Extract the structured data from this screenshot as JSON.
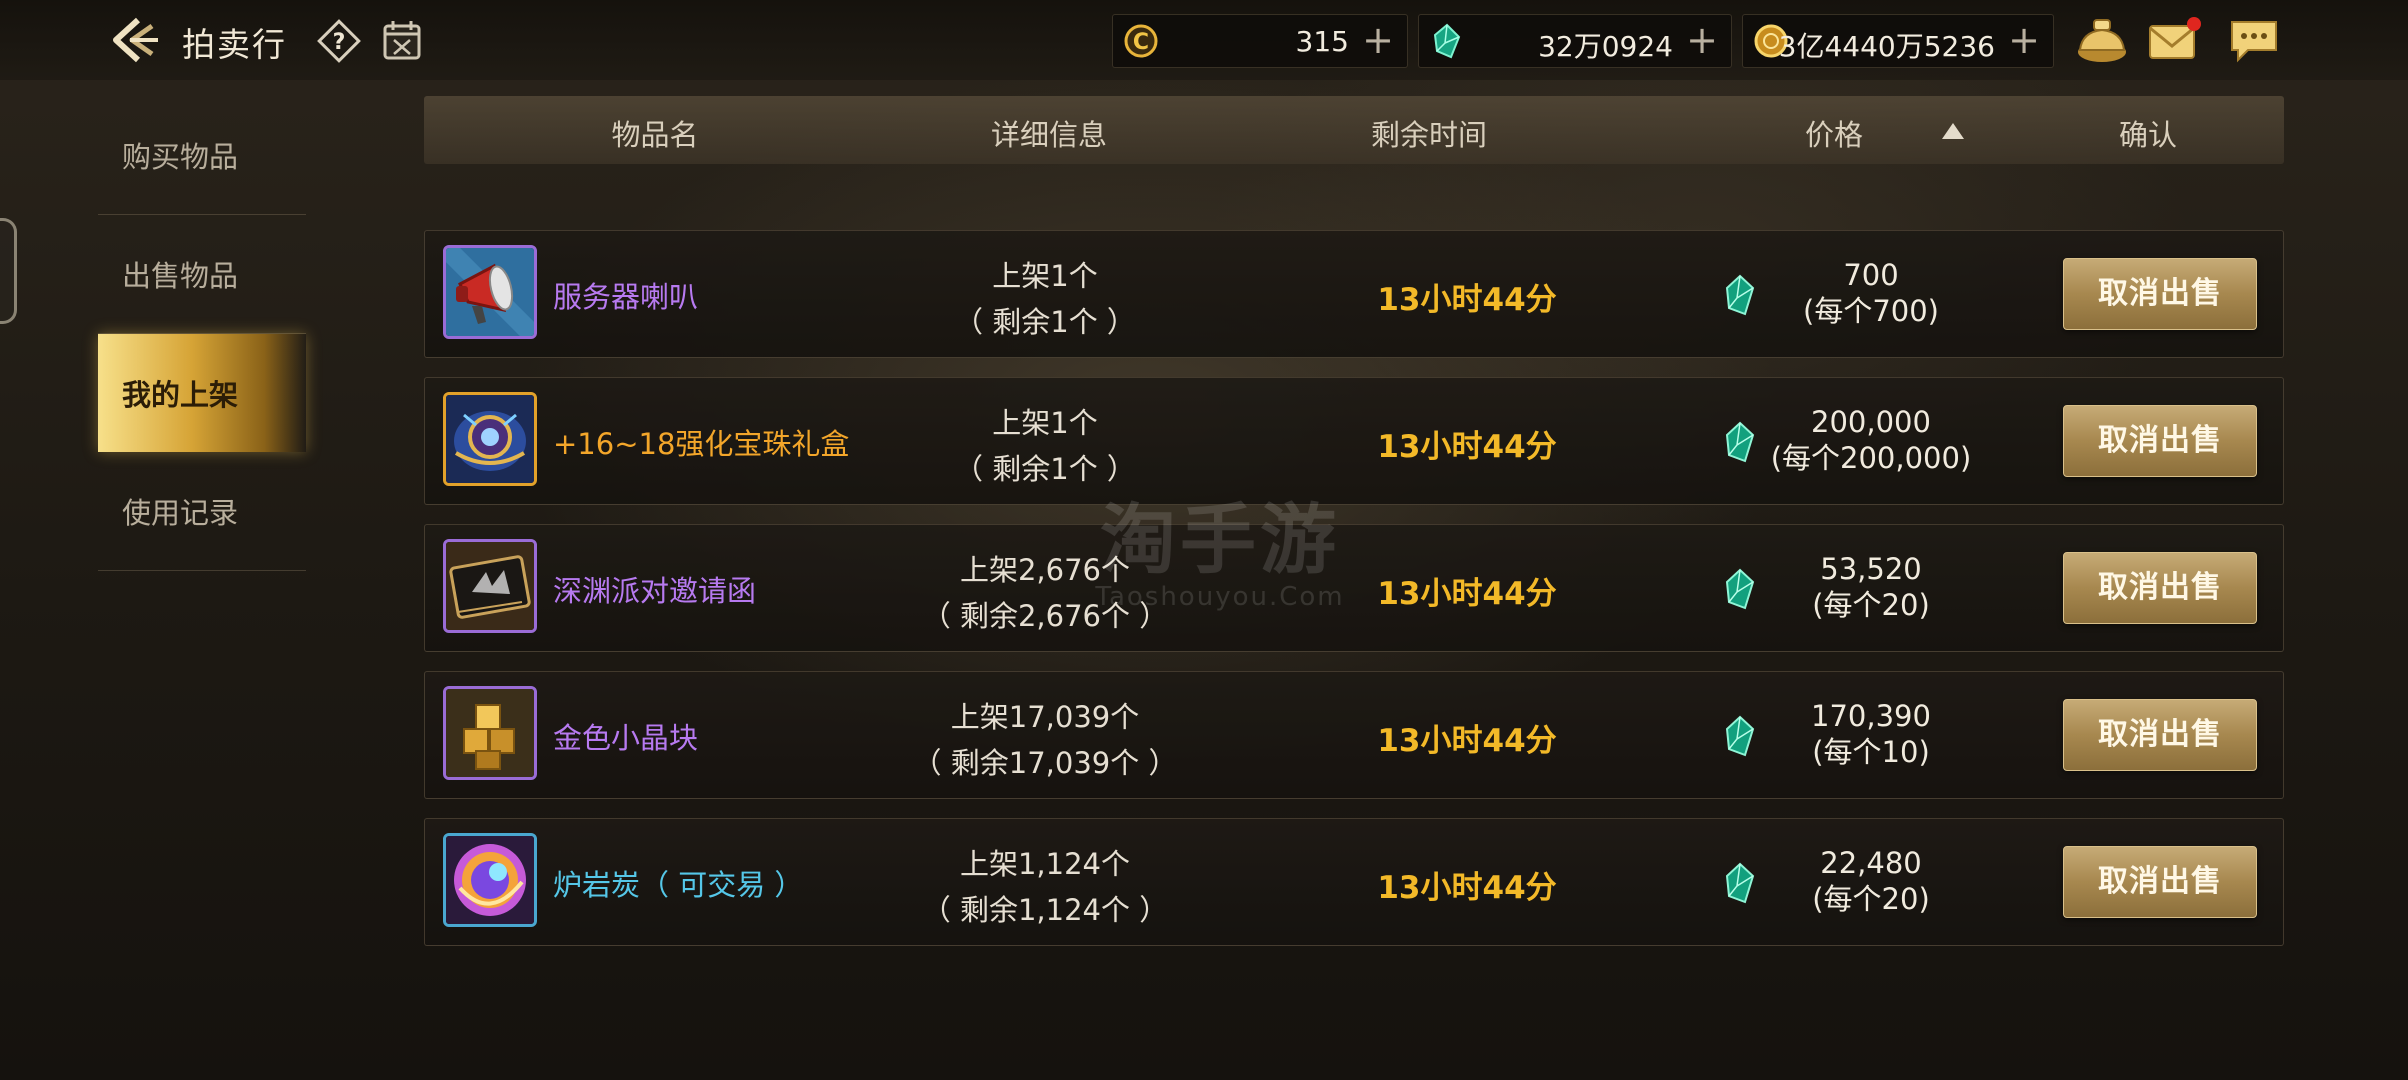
{
  "header": {
    "title": "拍卖行",
    "currencies": [
      {
        "name": "bind-coin",
        "value": "315",
        "color": "#f2c546"
      },
      {
        "name": "gem",
        "value": "32万0924",
        "color": "#2fd3a6"
      },
      {
        "name": "gold",
        "value": "3亿4440万5236",
        "color": "#e8b43a"
      }
    ]
  },
  "sidebar": {
    "items": [
      {
        "label": "购买物品",
        "active": false
      },
      {
        "label": "出售物品",
        "active": false
      },
      {
        "label": "我的上架",
        "active": true
      },
      {
        "label": "使用记录",
        "active": false
      }
    ]
  },
  "table": {
    "columns": [
      "物品名",
      "详细信息",
      "剩余时间",
      "价格",
      "确认"
    ],
    "sort_column": "剩余时间",
    "sort_direction": "ascending",
    "rows": [
      {
        "icon": "megaphone-icon",
        "name": "服务器喇叭",
        "name_color": "#b77af0",
        "listed": "上架1个",
        "remaining": "（ 剩余1个 ）",
        "time_left": "13小时44分",
        "total": "700",
        "unit": "(每个700)",
        "button": "取消出售"
      },
      {
        "icon": "orb-box-icon",
        "name": "+16~18强化宝珠礼盒",
        "name_color": "#f3a62a",
        "listed": "上架1个",
        "remaining": "（ 剩余1个 ）",
        "time_left": "13小时44分",
        "total": "200,000",
        "unit": "(每个200,000)",
        "button": "取消出售"
      },
      {
        "icon": "invitation-card-icon",
        "name": "深渊派对邀请函",
        "name_color": "#b77af0",
        "listed": "上架2,676个",
        "remaining": "（ 剩余2,676个 ）",
        "time_left": "13小时44分",
        "total": "53,520",
        "unit": "(每个20)",
        "button": "取消出售"
      },
      {
        "icon": "gold-crystal-icon",
        "name": "金色小晶块",
        "name_color": "#b77af0",
        "listed": "上架17,039个",
        "remaining": "（ 剩余17,039个 ）",
        "time_left": "13小时44分",
        "total": "170,390",
        "unit": "(每个10)",
        "button": "取消出售"
      },
      {
        "icon": "lava-orb-icon",
        "name": "炉岩炭（ 可交易 ）",
        "name_color": "#55c7e8",
        "listed": "上架1,124个",
        "remaining": "（ 剩余1,124个 ）",
        "time_left": "13小时44分",
        "total": "22,480",
        "unit": "(每个20)",
        "button": "取消出售"
      }
    ]
  },
  "watermark": {
    "main": "淘手游",
    "sub": "Taoshouyou.Com"
  }
}
